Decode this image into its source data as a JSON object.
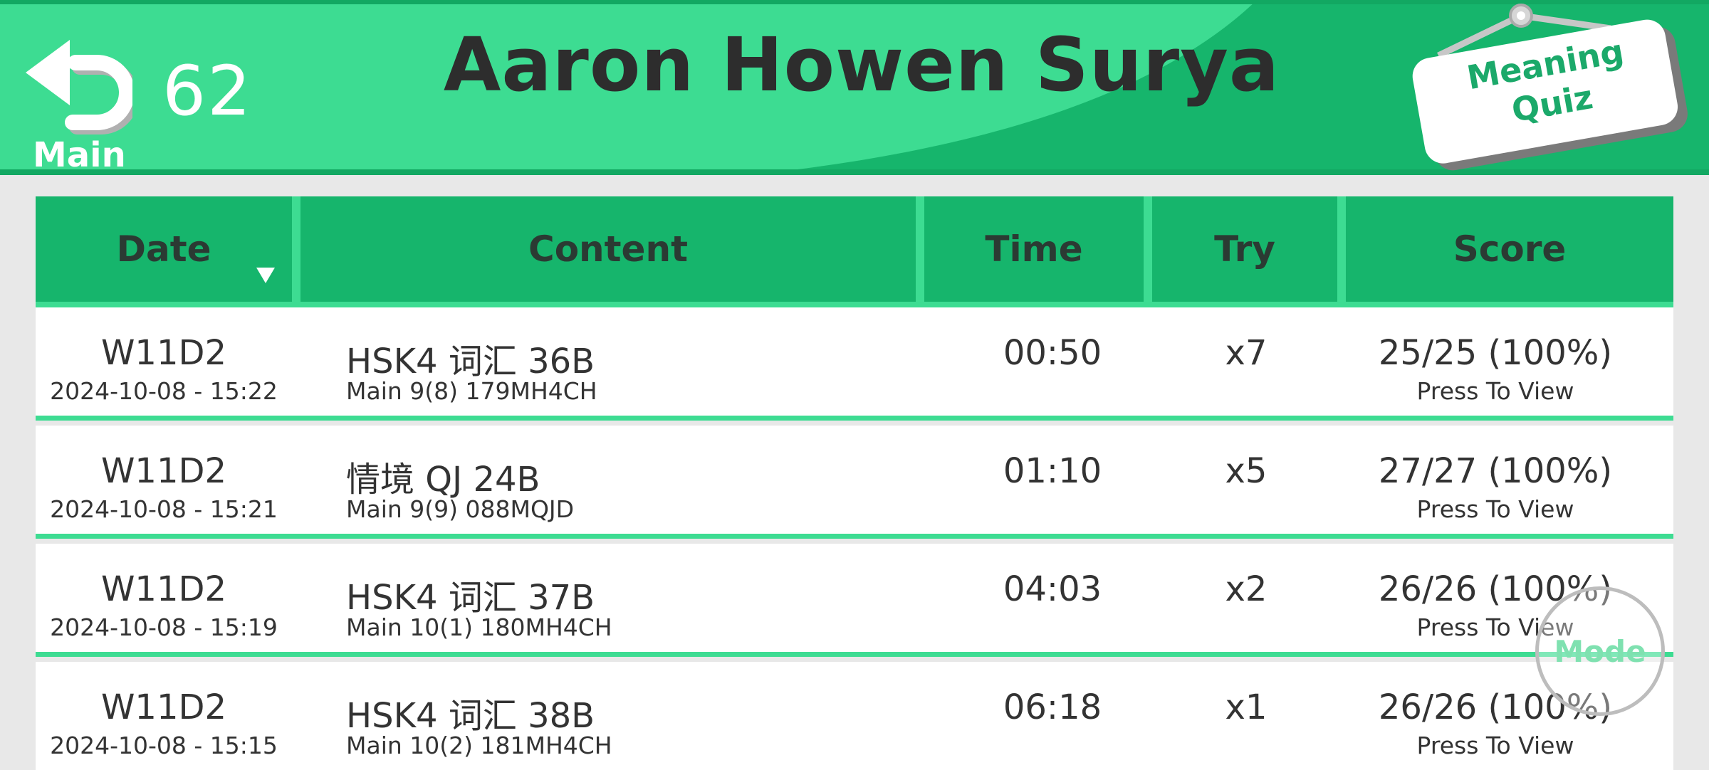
{
  "header": {
    "back_label": "Main",
    "counter": "62",
    "user_name": "Aaron Howen Surya",
    "quiz_label_line1": "Meaning",
    "quiz_label_line2": "Quiz",
    "colors": {
      "primary": "#16b56c",
      "light": "#3ddc92"
    },
    "icons": {
      "back": "undo-arrow-icon",
      "sort": "triangle-down-icon"
    }
  },
  "table": {
    "columns": [
      "Date",
      "Content",
      "Time",
      "Try",
      "Score"
    ],
    "sorted_by": "Date",
    "rows": [
      {
        "date": "W11D2",
        "datetime": "2024-10-08 - 15:22",
        "content": "HSK4 词汇 36B",
        "content_sub": "Main 9(8) 179MH4CH",
        "time": "00:50",
        "try": "x7",
        "score": "25/25 (100%)",
        "action": "Press To View"
      },
      {
        "date": "W11D2",
        "datetime": "2024-10-08 - 15:21",
        "content": "情境 QJ 24B",
        "content_sub": "Main 9(9) 088MQJD",
        "time": "01:10",
        "try": "x5",
        "score": "27/27 (100%)",
        "action": "Press To View"
      },
      {
        "date": "W11D2",
        "datetime": "2024-10-08 - 15:19",
        "content": "HSK4 词汇 37B",
        "content_sub": "Main 10(1) 180MH4CH",
        "time": "04:03",
        "try": "x2",
        "score": "26/26 (100%)",
        "action": "Press To View"
      },
      {
        "date": "W11D2",
        "datetime": "2024-10-08 - 15:15",
        "content": "HSK4 词汇 38B",
        "content_sub": "Main 10(2) 181MH4CH",
        "time": "06:18",
        "try": "x1",
        "score": "26/26 (100%)",
        "action": "Press To View"
      }
    ]
  },
  "mode_button": {
    "label": "Mode"
  }
}
